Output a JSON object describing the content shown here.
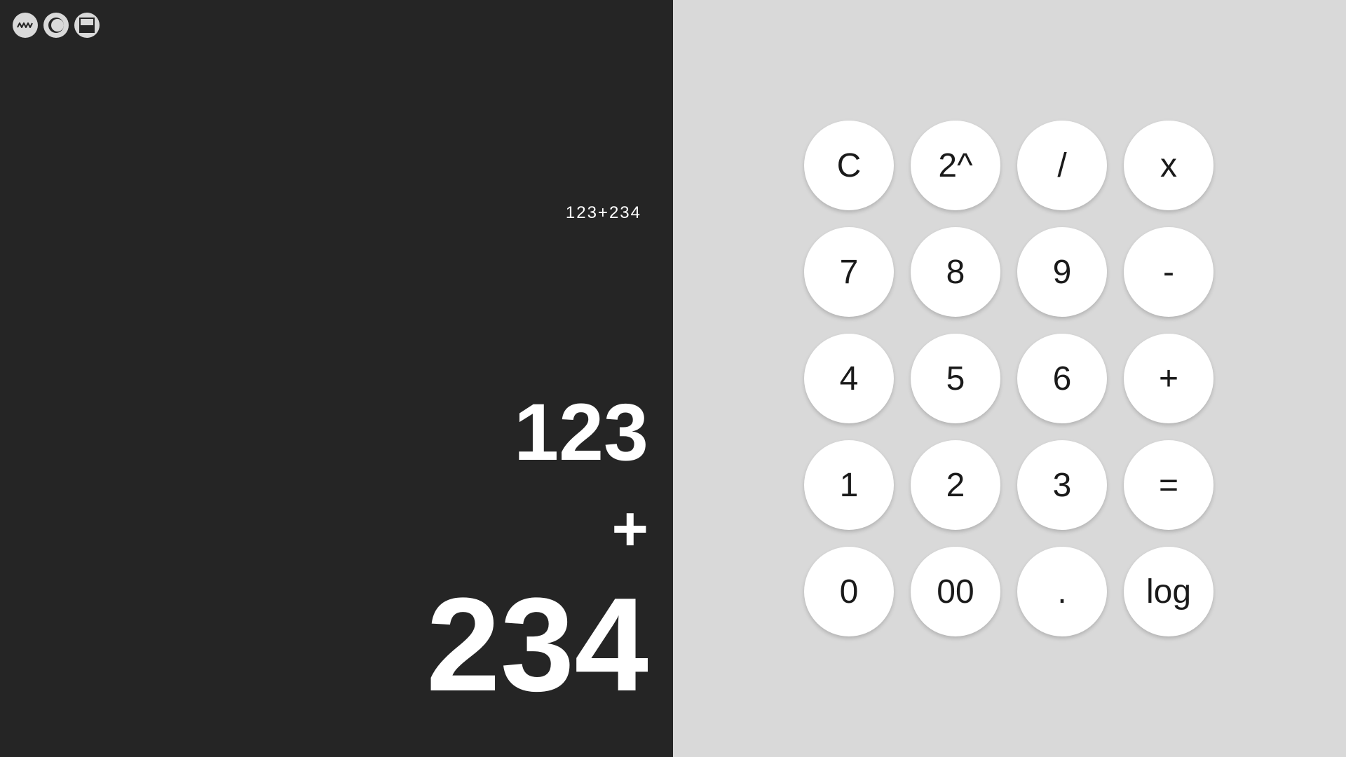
{
  "toolbar": {
    "icons": [
      "wave-icon",
      "theme-toggle-icon",
      "layout-split-icon"
    ]
  },
  "display": {
    "expression": "123+234",
    "operand1": "123",
    "operator": "+",
    "operand2": "234"
  },
  "keypad": {
    "keys": [
      "C",
      "2^",
      "/",
      "x",
      "7",
      "8",
      "9",
      "-",
      "4",
      "5",
      "6",
      "+",
      "1",
      "2",
      "3",
      "=",
      "0",
      "00",
      ".",
      "log"
    ]
  },
  "colors": {
    "display_bg": "#252525",
    "keypad_bg": "#d9d9d9",
    "key_bg": "#ffffff",
    "display_text": "#ffffff"
  }
}
